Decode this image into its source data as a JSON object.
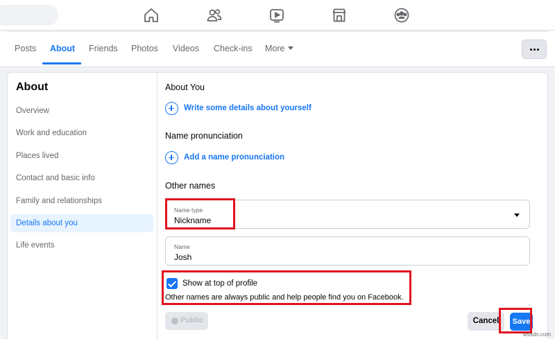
{
  "topnav": {
    "icons": [
      "home-icon",
      "friends-icon",
      "watch-icon",
      "marketplace-icon",
      "groups-icon"
    ]
  },
  "tabs": {
    "items": [
      "Posts",
      "About",
      "Friends",
      "Photos",
      "Videos",
      "Check-ins",
      "More"
    ],
    "active": "About"
  },
  "sidebar": {
    "title": "About",
    "items": [
      "Overview",
      "Work and education",
      "Places lived",
      "Contact and basic info",
      "Family and relationships",
      "Details about you",
      "Life events"
    ],
    "active": "Details about you"
  },
  "content": {
    "about_you": {
      "title": "About You",
      "link": "Write some details about yourself"
    },
    "pronunciation": {
      "title": "Name pronunciation",
      "link": "Add a name pronunciation"
    },
    "other_names": {
      "title": "Other names",
      "name_type_label": "Name type",
      "name_type_value": "Nickname",
      "name_label": "Name",
      "name_value": "Josh",
      "show_top_label": "Show at top of profile",
      "show_top_checked": true,
      "helper": "Other names are always public and help people find you on Facebook."
    },
    "buttons": {
      "privacy": "Public",
      "cancel": "Cancel",
      "save": "Save"
    }
  },
  "watermark": "wsxdn.com",
  "colors": {
    "accent": "#1877f2",
    "highlight": "#e0121f"
  }
}
